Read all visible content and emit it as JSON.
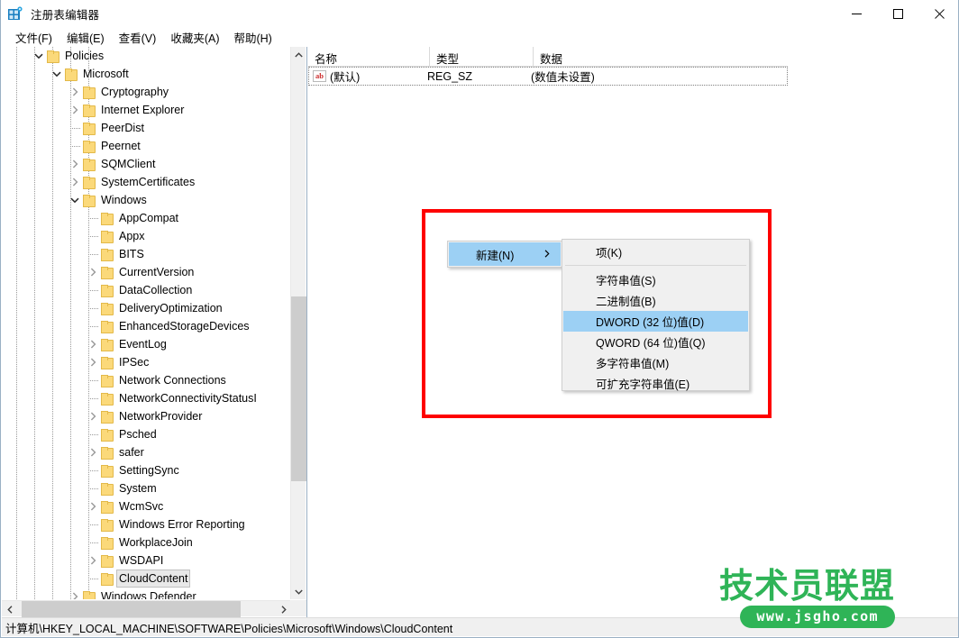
{
  "window": {
    "title": "注册表编辑器",
    "icon": "registry-editor-icon",
    "minimize_label": "—",
    "maximize_label": "☐",
    "close_label": "✕"
  },
  "menubar": {
    "items": [
      {
        "label": "文件(F)",
        "name": "menu-file"
      },
      {
        "label": "编辑(E)",
        "name": "menu-edit"
      },
      {
        "label": "查看(V)",
        "name": "menu-view"
      },
      {
        "label": "收藏夹(A)",
        "name": "menu-favorites"
      },
      {
        "label": "帮助(H)",
        "name": "menu-help"
      }
    ]
  },
  "tree": {
    "items": [
      {
        "label": "Policies",
        "depth": 3,
        "expander": "expanded",
        "selected": false
      },
      {
        "label": "Microsoft",
        "depth": 4,
        "expander": "expanded",
        "selected": false
      },
      {
        "label": "Cryptography",
        "depth": 5,
        "expander": "collapsed",
        "selected": false
      },
      {
        "label": "Internet Explorer",
        "depth": 5,
        "expander": "collapsed",
        "selected": false
      },
      {
        "label": "PeerDist",
        "depth": 5,
        "expander": "none",
        "selected": false
      },
      {
        "label": "Peernet",
        "depth": 5,
        "expander": "none",
        "selected": false
      },
      {
        "label": "SQMClient",
        "depth": 5,
        "expander": "collapsed",
        "selected": false
      },
      {
        "label": "SystemCertificates",
        "depth": 5,
        "expander": "collapsed",
        "selected": false
      },
      {
        "label": "Windows",
        "depth": 5,
        "expander": "expanded",
        "selected": false
      },
      {
        "label": "AppCompat",
        "depth": 6,
        "expander": "none",
        "selected": false
      },
      {
        "label": "Appx",
        "depth": 6,
        "expander": "none",
        "selected": false
      },
      {
        "label": "BITS",
        "depth": 6,
        "expander": "none",
        "selected": false
      },
      {
        "label": "CurrentVersion",
        "depth": 6,
        "expander": "collapsed",
        "selected": false
      },
      {
        "label": "DataCollection",
        "depth": 6,
        "expander": "none",
        "selected": false
      },
      {
        "label": "DeliveryOptimization",
        "depth": 6,
        "expander": "none",
        "selected": false
      },
      {
        "label": "EnhancedStorageDevices",
        "depth": 6,
        "expander": "none",
        "selected": false
      },
      {
        "label": "EventLog",
        "depth": 6,
        "expander": "collapsed",
        "selected": false
      },
      {
        "label": "IPSec",
        "depth": 6,
        "expander": "collapsed",
        "selected": false
      },
      {
        "label": "Network Connections",
        "depth": 6,
        "expander": "none",
        "selected": false
      },
      {
        "label": "NetworkConnectivityStatusI",
        "depth": 6,
        "expander": "none",
        "selected": false
      },
      {
        "label": "NetworkProvider",
        "depth": 6,
        "expander": "collapsed",
        "selected": false
      },
      {
        "label": "Psched",
        "depth": 6,
        "expander": "none",
        "selected": false
      },
      {
        "label": "safer",
        "depth": 6,
        "expander": "collapsed",
        "selected": false
      },
      {
        "label": "SettingSync",
        "depth": 6,
        "expander": "none",
        "selected": false
      },
      {
        "label": "System",
        "depth": 6,
        "expander": "none",
        "selected": false
      },
      {
        "label": "WcmSvc",
        "depth": 6,
        "expander": "collapsed",
        "selected": false
      },
      {
        "label": "Windows Error Reporting",
        "depth": 6,
        "expander": "none",
        "selected": false
      },
      {
        "label": "WorkplaceJoin",
        "depth": 6,
        "expander": "none",
        "selected": false
      },
      {
        "label": "WSDAPI",
        "depth": 6,
        "expander": "collapsed",
        "selected": false
      },
      {
        "label": "CloudContent",
        "depth": 6,
        "expander": "none",
        "selected": true
      },
      {
        "label": "Windows Defender",
        "depth": 5,
        "expander": "collapsed",
        "selected": false
      }
    ]
  },
  "list": {
    "columns": [
      "名称",
      "类型",
      "数据"
    ],
    "rows": [
      {
        "icon": "ab-string-icon",
        "name": "(默认)",
        "type": "REG_SZ",
        "data": "(数值未设置)"
      }
    ]
  },
  "context_menu": {
    "parent": {
      "label": "新建(N)",
      "submenu_arrow": "›",
      "highlighted": true
    },
    "submenu_items": [
      {
        "label": "项(K)",
        "highlighted": false,
        "separator_after": true
      },
      {
        "label": "字符串值(S)",
        "highlighted": false,
        "separator_after": false
      },
      {
        "label": "二进制值(B)",
        "highlighted": false,
        "separator_after": false
      },
      {
        "label": "DWORD (32 位)值(D)",
        "highlighted": true,
        "separator_after": false
      },
      {
        "label": "QWORD (64 位)值(Q)",
        "highlighted": false,
        "separator_after": false
      },
      {
        "label": "多字符串值(M)",
        "highlighted": false,
        "separator_after": false
      },
      {
        "label": "可扩充字符串值(E)",
        "highlighted": false,
        "separator_after": false
      }
    ]
  },
  "statusbar": {
    "path": "计算机\\HKEY_LOCAL_MACHINE\\SOFTWARE\\Policies\\Microsoft\\Windows\\CloudContent"
  },
  "watermark": {
    "brand": "技术员联盟",
    "url": "www.jsgho.com"
  },
  "colors": {
    "menu_highlight": "#9cd0f4",
    "annotation_red": "#fe0000",
    "folder_yellow": "#fbd97a",
    "watermark_green": "#2fb457",
    "selection_gray": "#e8e8e8"
  }
}
